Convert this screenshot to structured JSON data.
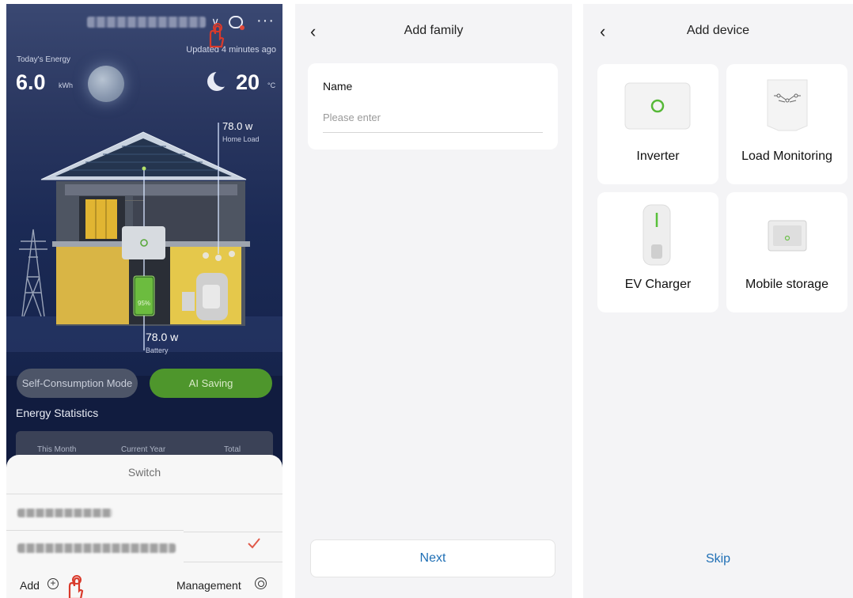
{
  "home_panel": {
    "updated_text": "Updated 4 minutes ago",
    "today_energy_label": "Today's Energy",
    "today_energy_value": "6.0",
    "today_energy_unit": "kWh",
    "temperature_value": "20",
    "temperature_unit": "°C",
    "home_load_value": "78.0 w",
    "home_load_label": "Home Load",
    "battery_value": "78.0 w",
    "battery_label": "Battery",
    "battery_percent": "95%",
    "battery_level": 0.95,
    "modes": [
      {
        "label": "Self-Consumption Mode",
        "selected": false
      },
      {
        "label": "AI Saving",
        "selected": true
      }
    ],
    "stats_title": "Energy Statistics",
    "stats_tabs": [
      "This Month",
      "Current Year",
      "Total"
    ],
    "switch_sheet": {
      "title": "Switch",
      "add_label": "Add",
      "management_label": "Management"
    }
  },
  "add_family": {
    "title": "Add family",
    "name_label": "Name",
    "name_placeholder": "Please enter",
    "next_label": "Next"
  },
  "add_device": {
    "title": "Add device",
    "devices": [
      {
        "label": "Inverter"
      },
      {
        "label": "Load Monitoring"
      },
      {
        "label": "EV Charger"
      },
      {
        "label": "Mobile storage"
      }
    ],
    "skip_label": "Skip"
  },
  "colors": {
    "accent_green": "#4e962c",
    "link_blue": "#1f6fb5",
    "tap_red": "#d93a2b"
  }
}
